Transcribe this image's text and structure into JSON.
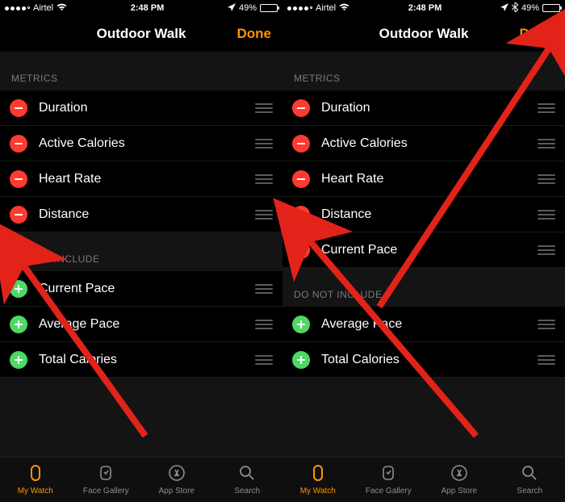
{
  "status": {
    "carrier": "Airtel",
    "time": "2:48 PM",
    "battery_pct": "49%",
    "battery_fill": 49
  },
  "nav": {
    "title": "Outdoor Walk",
    "done": "Done"
  },
  "sections": {
    "metrics_head": "METRICS",
    "exclude_head": "DO NOT INCLUDE"
  },
  "left": {
    "metrics": [
      {
        "label": "Duration"
      },
      {
        "label": "Active Calories"
      },
      {
        "label": "Heart Rate"
      },
      {
        "label": "Distance"
      }
    ],
    "exclude": [
      {
        "label": "Current Pace"
      },
      {
        "label": "Average Pace"
      },
      {
        "label": "Total Calories"
      }
    ]
  },
  "right": {
    "metrics": [
      {
        "label": "Duration"
      },
      {
        "label": "Active Calories"
      },
      {
        "label": "Heart Rate"
      },
      {
        "label": "Distance"
      },
      {
        "label": "Current Pace"
      }
    ],
    "exclude": [
      {
        "label": "Average Pace"
      },
      {
        "label": "Total Calories"
      }
    ]
  },
  "tabs": {
    "my_watch": "My Watch",
    "face_gallery": "Face Gallery",
    "app_store": "App Store",
    "search": "Search"
  }
}
